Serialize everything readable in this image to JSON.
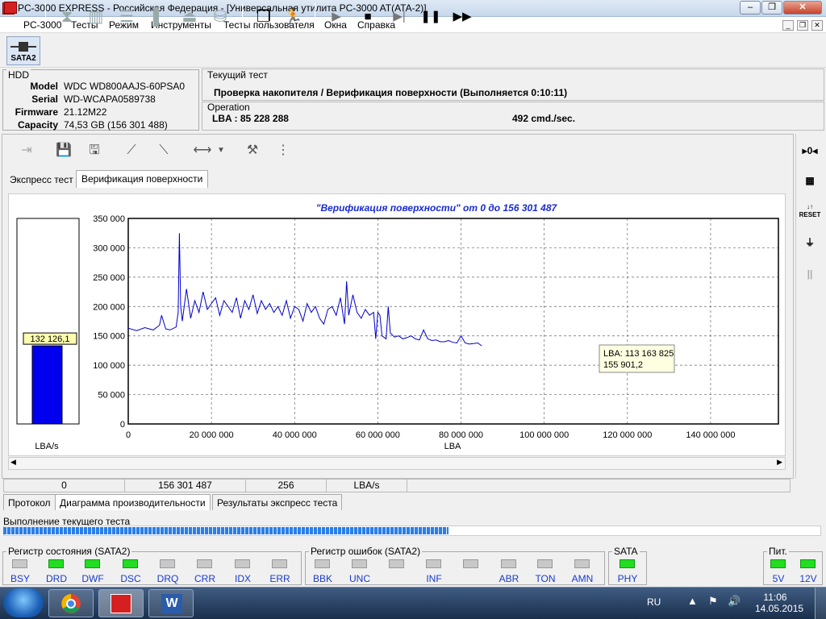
{
  "window": {
    "title": "PC-3000 EXPRESS - Российская Федерация - [Универсальная утилита PC-3000 AT(ATA-2)]"
  },
  "menu": {
    "items": [
      "PC-3000",
      "Тесты",
      "Режим",
      "Инструменты",
      "Тесты пользователя",
      "Окна",
      "Справка"
    ]
  },
  "toolbar": {
    "sata_label": "SATA2"
  },
  "hdd": {
    "legend": "HDD",
    "model_label": "Model",
    "model": "WDC WD800AAJS-60PSA0",
    "serial_label": "Serial",
    "serial": "WD-WCAPA0589738",
    "firmware_label": "Firmware",
    "firmware": "21.12M22",
    "capacity_label": "Capacity",
    "capacity": "74,53 GB (156 301 488)"
  },
  "current_test": {
    "legend": "Текущий тест",
    "text": "Проверка накопителя / Верификация поверхности (Выполняется 0:10:11)"
  },
  "operation": {
    "legend": "Operation",
    "lba": "LBA : 85 228 288",
    "rate": "492 cmd./sec."
  },
  "tabs": {
    "express": "Экспресс тест",
    "verify": "Верификация поверхности"
  },
  "bar_gauge": {
    "value_label": "132 126,1",
    "fraction": 0.38,
    "unit": "LBA/s"
  },
  "tooltip": {
    "line1": "LBA: 113 163 825",
    "line2": "155 901,2"
  },
  "chart_data": {
    "type": "line",
    "title": "\"Верификация поверхности\" от 0 до 156 301 487",
    "xlabel": "LBA",
    "ylabel": "",
    "xlim": [
      0,
      156301487
    ],
    "ylim": [
      0,
      350000
    ],
    "x_ticks": [
      "0",
      "20 000 000",
      "40 000 000",
      "60 000 000",
      "80 000 000",
      "100 000 000",
      "120 000 000",
      "140 000 000"
    ],
    "y_ticks": [
      "0",
      "50 000",
      "100 000",
      "150 000",
      "200 000",
      "250 000",
      "300 000",
      "350 000"
    ],
    "grid": true,
    "series": [
      {
        "color": "#0000cc",
        "x": [
          0,
          2000000,
          4000000,
          6000000,
          7500000,
          8000000,
          9000000,
          10000000,
          11500000,
          12000000,
          12300000,
          12600000,
          13000000,
          14000000,
          15000000,
          16000000,
          17000000,
          18000000,
          19000000,
          20000000,
          21000000,
          22000000,
          23000000,
          24000000,
          25000000,
          26000000,
          27000000,
          28000000,
          29000000,
          30000000,
          31000000,
          32000000,
          33000000,
          34000000,
          35000000,
          36000000,
          37000000,
          38000000,
          39000000,
          40000000,
          41000000,
          42000000,
          43000000,
          44000000,
          45000000,
          46000000,
          47000000,
          48000000,
          49000000,
          50000000,
          51000000,
          52000000,
          52500000,
          53000000,
          54000000,
          55000000,
          56000000,
          57000000,
          58000000,
          59000000,
          59500000,
          60000000,
          60500000,
          61000000,
          62000000,
          62500000,
          63000000,
          64000000,
          65000000,
          66000000,
          67000000,
          68000000,
          69000000,
          70000000,
          71000000,
          72000000,
          73000000,
          74000000,
          75000000,
          76000000,
          77000000,
          78000000,
          79000000,
          80000000,
          81000000,
          82000000,
          83000000,
          84000000,
          85000000
        ],
        "y": [
          163000,
          159000,
          164000,
          160000,
          168000,
          185000,
          162000,
          160000,
          165000,
          190000,
          325000,
          200000,
          175000,
          230000,
          180000,
          210000,
          190000,
          225000,
          195000,
          205000,
          215000,
          185000,
          210000,
          200000,
          190000,
          215000,
          180000,
          210000,
          195000,
          220000,
          188000,
          210000,
          195000,
          205000,
          190000,
          200000,
          185000,
          210000,
          180000,
          200000,
          195000,
          175000,
          205000,
          190000,
          200000,
          180000,
          170000,
          195000,
          200000,
          185000,
          215000,
          170000,
          243000,
          185000,
          220000,
          190000,
          180000,
          195000,
          185000,
          190000,
          145000,
          190000,
          185000,
          150000,
          145000,
          200000,
          155000,
          148000,
          150000,
          145000,
          147000,
          150000,
          145000,
          143000,
          160000,
          145000,
          142000,
          143000,
          140000,
          140000,
          142000,
          139000,
          138000,
          150000,
          138000,
          136000,
          137000,
          138000,
          133000
        ]
      }
    ]
  }
}
